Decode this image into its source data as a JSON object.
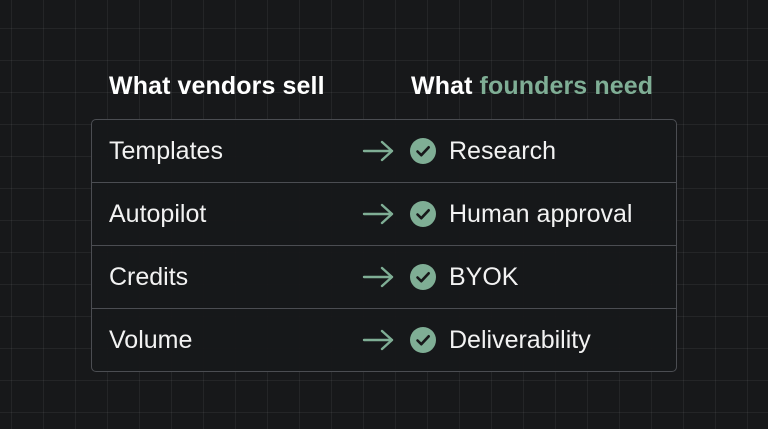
{
  "headers": {
    "left": "What vendors sell",
    "right_prefix": "What",
    "right_accent": "founders need"
  },
  "rows": [
    {
      "from": "Templates",
      "to": "Research"
    },
    {
      "from": "Autopilot",
      "to": "Human approval"
    },
    {
      "from": "Credits",
      "to": "BYOK"
    },
    {
      "from": "Volume",
      "to": "Deliverability"
    }
  ],
  "icons": {
    "arrow": "right-arrow-icon",
    "check": "check-circle-icon"
  },
  "colors": {
    "background": "#17181a",
    "accent": "#7fae95",
    "border": "#4b4d52",
    "text": "#f2f2f2"
  }
}
